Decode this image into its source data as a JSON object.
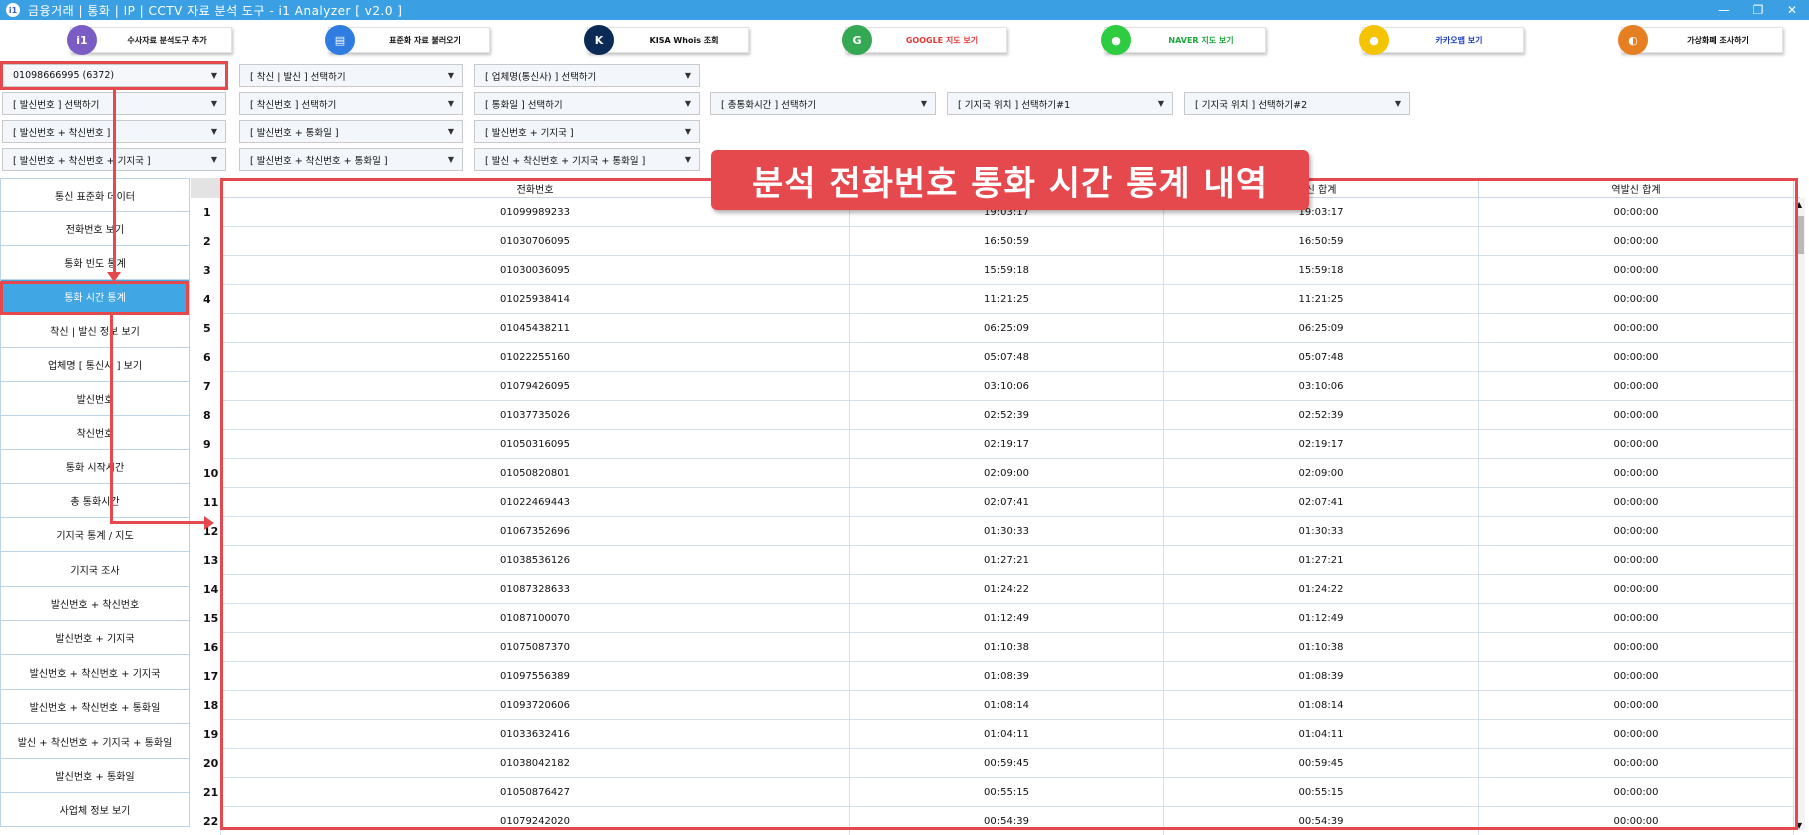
{
  "window": {
    "title": "금융거래 | 통화 | IP | CCTV 자료 분석 도구 - i1 Analyzer [ v2.0 ]",
    "app_icon": "i1",
    "controls": [
      "—",
      "❐",
      "✕"
    ]
  },
  "toolbar": [
    {
      "label": "수사자료 분석도구 추가",
      "icon": "i1-logo-icon",
      "icon_text": "i1",
      "color": "#7b5cc4"
    },
    {
      "label": "표준화 자료 불러오기",
      "icon": "document-icon",
      "icon_text": "▤",
      "color": "#2f7de1"
    },
    {
      "label": "KISA Whois 조회",
      "icon": "kisa-logo-icon",
      "icon_text": "K",
      "color": "#0b2a55"
    },
    {
      "label": "GOOGLE 지도 보기",
      "icon": "google-maps-icon",
      "icon_text": "G",
      "color": "#34a853",
      "text_color": "#e53935"
    },
    {
      "label": "NAVER 지도 보기",
      "icon": "naver-map-icon",
      "icon_text": "●",
      "color": "#2ecc40",
      "text_color": "#1aa63a"
    },
    {
      "label": "카카오맵 보기",
      "icon": "kakao-map-icon",
      "icon_text": "●",
      "color": "#f5c400",
      "text_color": "#1d3fbf"
    },
    {
      "label": "가상화폐 조사하기",
      "icon": "crypto-icon",
      "icon_text": "◐",
      "color": "#e67e22"
    }
  ],
  "filters": {
    "phone": "01098666995 (6372)",
    "incoming_outgoing": "[ 착신 | 발신 ] 선택하기",
    "carrier": "[ 업체명(통신사) ] 선택하기",
    "caller": "[ 발신번호 ] 선택하기",
    "callee": "[ 착신번호 ] 선택하기",
    "call_date": "[ 통화일 ] 선택하기",
    "total_duration": "[ 총통화시간 ] 선택하기",
    "cell_tower_1": "[ 기지국 위치 ] 선택하기#1",
    "cell_tower_2": "[ 기지국 위치 ] 선택하기#2",
    "caller_callee": "[ 발신번호 + 착신번호 ]",
    "caller_date": "[ 발신번호 + 통화일 ]",
    "caller_tower": "[ 발신번호 + 기지국 ]",
    "caller_callee_tower": "[ 발신번호 + 착신번호 + 기지국 ]",
    "caller_callee_date": "[ 발신번호 + 착신번호 + 통화일 ]",
    "all_combo": "[ 발신 + 착신번호 + 기지국 + 통화일 ]"
  },
  "sidebar": [
    "통신 표준화 데이터",
    "전화번호 보기",
    "통화 빈도 통계",
    "통화 시간 통계",
    "착신 | 발신 정보 보기",
    "업체명 [ 통신사 ] 보기",
    "발신번호",
    "착신번호",
    "통화 시작시간",
    "총 통화시간",
    "기지국 통계 / 지도",
    "기지국 조사",
    "발신번호 + 착신번호",
    "발신번호 + 기지국",
    "발신번호 + 착신번호 + 기지국",
    "발신번호 + 착신번호 + 통화일",
    "발신 + 착신번호 + 기지국 + 통화일",
    "발신번호 + 통화일",
    "사업체 정보 보기"
  ],
  "sidebar_active_index": 3,
  "banner": "분석 전화번호 통화 시간 통계 내역",
  "table": {
    "columns": [
      "전화번호",
      "",
      "신 합계",
      "역발신 합계"
    ],
    "rows": [
      [
        "1",
        "01099989233",
        "19:03:17",
        "19:03:17",
        "00:00:00"
      ],
      [
        "2",
        "01030706095",
        "16:50:59",
        "16:50:59",
        "00:00:00"
      ],
      [
        "3",
        "01030036095",
        "15:59:18",
        "15:59:18",
        "00:00:00"
      ],
      [
        "4",
        "01025938414",
        "11:21:25",
        "11:21:25",
        "00:00:00"
      ],
      [
        "5",
        "01045438211",
        "06:25:09",
        "06:25:09",
        "00:00:00"
      ],
      [
        "6",
        "01022255160",
        "05:07:48",
        "05:07:48",
        "00:00:00"
      ],
      [
        "7",
        "01079426095",
        "03:10:06",
        "03:10:06",
        "00:00:00"
      ],
      [
        "8",
        "01037735026",
        "02:52:39",
        "02:52:39",
        "00:00:00"
      ],
      [
        "9",
        "01050316095",
        "02:19:17",
        "02:19:17",
        "00:00:00"
      ],
      [
        "10",
        "01050820801",
        "02:09:00",
        "02:09:00",
        "00:00:00"
      ],
      [
        "11",
        "01022469443",
        "02:07:41",
        "02:07:41",
        "00:00:00"
      ],
      [
        "12",
        "01067352696",
        "01:30:33",
        "01:30:33",
        "00:00:00"
      ],
      [
        "13",
        "01038536126",
        "01:27:21",
        "01:27:21",
        "00:00:00"
      ],
      [
        "14",
        "01087328633",
        "01:24:22",
        "01:24:22",
        "00:00:00"
      ],
      [
        "15",
        "01087100070",
        "01:12:49",
        "01:12:49",
        "00:00:00"
      ],
      [
        "16",
        "01075087370",
        "01:10:38",
        "01:10:38",
        "00:00:00"
      ],
      [
        "17",
        "01097556389",
        "01:08:39",
        "01:08:39",
        "00:00:00"
      ],
      [
        "18",
        "01093720606",
        "01:08:14",
        "01:08:14",
        "00:00:00"
      ],
      [
        "19",
        "01033632416",
        "01:04:11",
        "01:04:11",
        "00:00:00"
      ],
      [
        "20",
        "01038042182",
        "00:59:45",
        "00:59:45",
        "00:00:00"
      ],
      [
        "21",
        "01050876427",
        "00:55:15",
        "00:55:15",
        "00:00:00"
      ],
      [
        "22",
        "01079242020",
        "00:54:39",
        "00:54:39",
        "00:00:00"
      ]
    ]
  }
}
